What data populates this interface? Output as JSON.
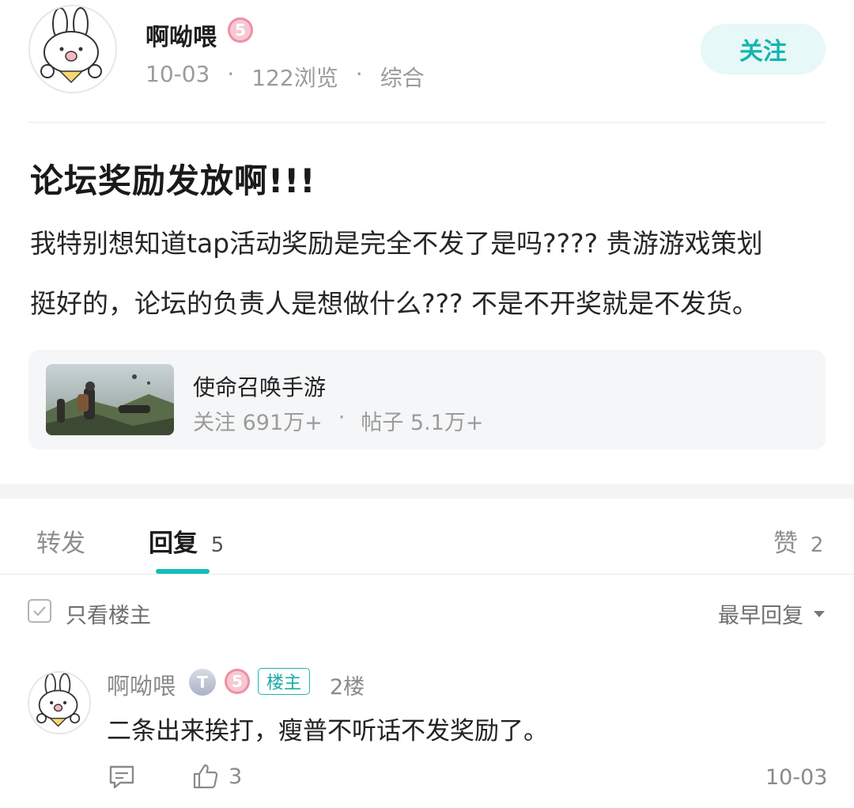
{
  "author": {
    "name": "啊呦喂",
    "level": "5"
  },
  "meta": {
    "date": "10-03",
    "views": "122浏览",
    "category": "综合",
    "sep": "·"
  },
  "follow_label": "关注",
  "post": {
    "title": "论坛奖励发放啊!!!",
    "body_line1": "我特别想知道tap活动奖励是完全不发了是吗???? 贵游游戏策划",
    "body_line2": "挺好的，论坛的负责人是想做什么??? 不是不开奖就是不发货。"
  },
  "game": {
    "name": "使命召唤手游",
    "follow": "关注 691万+",
    "sep": "·",
    "posts": "帖子 5.1万+"
  },
  "tabs": {
    "forward": "转发",
    "reply": "回复",
    "reply_count": "5",
    "like": "赞",
    "like_count": "2"
  },
  "filter": {
    "only_op": "只看楼主",
    "sort": "最早回复"
  },
  "reply": {
    "name": "啊呦喂",
    "t_badge": "T",
    "level": "5",
    "op_tag": "楼主",
    "floor": "2楼",
    "text": "二条出来挨打，瘦普不听话不发奖励了。",
    "likes": "3",
    "date": "10-03"
  },
  "colors": {
    "accent": "#16bdb7",
    "follow_bg": "#e6f8f7",
    "level_pink": "#ef8fa4"
  },
  "icons": [
    "rabbit-avatar",
    "level-badge",
    "checkbox-icon",
    "caret-down-icon",
    "comment-icon",
    "thumbs-up-icon",
    "game-thumbnail"
  ]
}
